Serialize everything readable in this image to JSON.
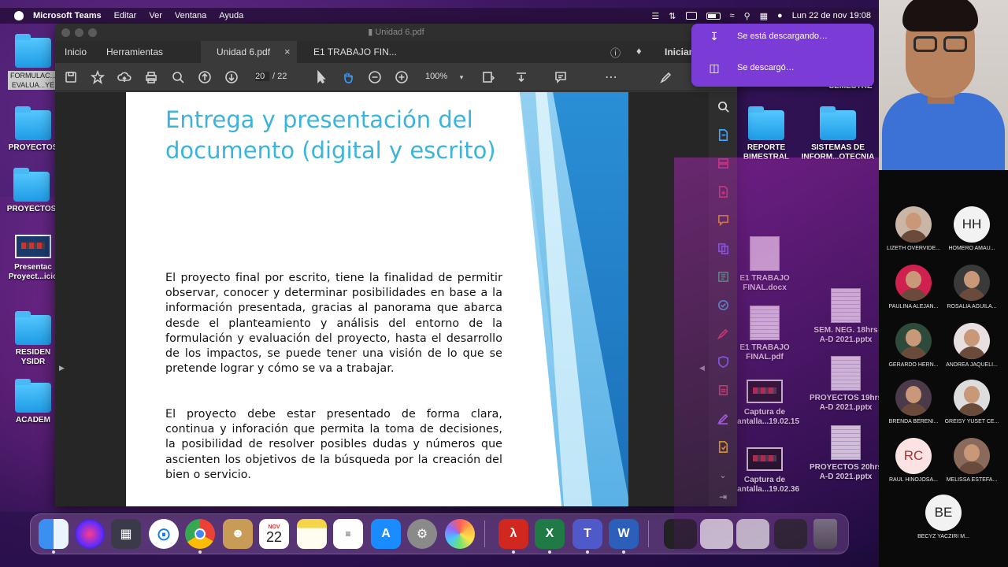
{
  "menubar": {
    "app": "Microsoft Teams",
    "items": [
      "Editar",
      "Ver",
      "Ventana",
      "Ayuda"
    ],
    "datetime": "Lun 22 de nov  19:08"
  },
  "desktop_icons": [
    {
      "label": "FORMULAC...\nEVALUA...YE",
      "type": "folder"
    },
    {
      "label": "PROYECTOS",
      "type": "folder"
    },
    {
      "label": "PROYECTOS",
      "type": "folder"
    },
    {
      "label": "Presentac\nProyect...icio",
      "type": "screenshot"
    },
    {
      "label": "RESIDEN\nYSIDR",
      "type": "folder"
    },
    {
      "label": "ACADEM",
      "type": "folder"
    },
    {
      "label": "REPORTE\nBIMESTRAL",
      "type": "folder"
    },
    {
      "label": "SISTEMAS DE\nINFORM...OTECNIA",
      "type": "folder"
    },
    {
      "label": "E1 TRABAJO\nFINAL.docx",
      "type": "docx"
    },
    {
      "label": "E1 TRABAJO\nFINAL.pdf",
      "type": "pdf"
    },
    {
      "label": "Captura de\npantalla...19.02.15",
      "type": "screenshot"
    },
    {
      "label": "Captura de\npantalla...19.02.36",
      "type": "screenshot"
    },
    {
      "label": "SEM. NEG. 18hrs\nA-D 2021.pptx",
      "type": "pptx"
    },
    {
      "label": "PROYECTOS 19hrs\nA-D 2021.pptx",
      "type": "pptx"
    },
    {
      "label": "PROYECTOS 20hrs\nA-D 2021.pptx",
      "type": "pptx"
    },
    {
      "label": "SEMESTRE",
      "type": "folder"
    }
  ],
  "pdf": {
    "window_title": "Unidad 6.pdf",
    "tabs": {
      "home": "Inicio",
      "tools": "Herramientas",
      "doc1": "Unidad 6.pdf",
      "doc2": "E1 TRABAJO FIN...",
      "sign_in": "Iniciar"
    },
    "page_current": "20",
    "page_total": "/ 22",
    "zoom": "100%",
    "slide": {
      "title": "Entrega y presentación del documento (digital y escrito)",
      "paragraph1": "El proyecto final por escrito, tiene la finalidad de permitir observar, conocer y determinar posibilidades en base a la información presentada, gracias al panorama que abarca desde el planteamiento y análisis del entorno de la formulación y evaluación del proyecto, hasta el desarrollo de los impactos, se puede tener una visión de lo que se pretende lograr y cómo se va a trabajar.",
      "paragraph2": "El proyecto debe estar presentado de forma clara, continua y inforación que permita la toma de decisiones, la posibilidad de resolver posibles dudas y números que ascienten los objetivos de la búsqueda por la creación del bien o servicio."
    }
  },
  "notification": {
    "downloading": "Se está descargando…",
    "downloaded": "Se descargó…"
  },
  "dock": {
    "calendar_month": "NOV",
    "calendar_day": "22"
  },
  "teams": {
    "participants": [
      {
        "name": "LIZETH OVERVIDE...",
        "initials": ""
      },
      {
        "name": "HOMERO AMAU...",
        "initials": "HH"
      },
      {
        "name": "PAULINA ALEJAN...",
        "initials": ""
      },
      {
        "name": "ROSALIA AGUILA...",
        "initials": ""
      },
      {
        "name": "GERARDO HERN...",
        "initials": ""
      },
      {
        "name": "ANDREA JAQUELI...",
        "initials": ""
      },
      {
        "name": "BRENDA BERENI...",
        "initials": ""
      },
      {
        "name": "GREISY YUSET CE...",
        "initials": ""
      },
      {
        "name": "RAUL HINOJOSA...",
        "initials": "RC"
      },
      {
        "name": "MELISSA ESTEFA...",
        "initials": ""
      },
      {
        "name": "BECYZ YACZIRI M...",
        "initials": "BE"
      }
    ]
  },
  "colors": {
    "slide_title": "#3bb4dc",
    "notification": "#7b3bd6",
    "acrobat_red": "#d0281f",
    "excel_green": "#1f7a45",
    "word_blue": "#2b5fb9"
  }
}
